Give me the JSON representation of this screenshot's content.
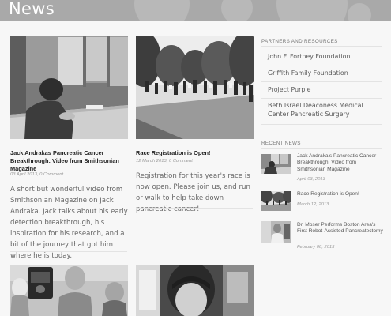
{
  "page": {
    "title": "News"
  },
  "posts": [
    {
      "title": "Jack Andrakas Pancreatic Cancer Breakthrough: Video from Smithsonian Magazine",
      "meta": "03 April 2013, 0 Comment",
      "excerpt": "A short but wonderful video from Smithsonian Magazine on Jack Andraka. Jack talks about his early detection breakthrough, his inspiration for his research, and a bit of the journey that got him where he is today."
    },
    {
      "title": "Race Registration is Open!",
      "meta": "12 March 2013, 0 Comment",
      "excerpt": "Registration for this year's race is now open. Please join us, and run or walk to help take down pancreatic cancer!"
    }
  ],
  "sidebar": {
    "partners_heading": "PARTNERS AND RESOURCES",
    "partners": [
      "John F. Fortney Foundation",
      "Griffith Family Foundation",
      "Project Purple",
      "Beth Israel Deaconess Medical Center Pancreatic Surgery"
    ],
    "recent_heading": "RECENT NEWS",
    "recent": [
      {
        "title": "Jack Andraka's Pancreatic Cancer Breakthrough: Video from Smithsonian Magazine",
        "date": "April 03, 2013"
      },
      {
        "title": "Race Registration is Open!",
        "date": "March 12, 2013"
      },
      {
        "title": "Dr. Moser Performs Boston Area's First Robot-Assisted Pancreatectomy",
        "date": "February 08, 2013"
      }
    ]
  }
}
